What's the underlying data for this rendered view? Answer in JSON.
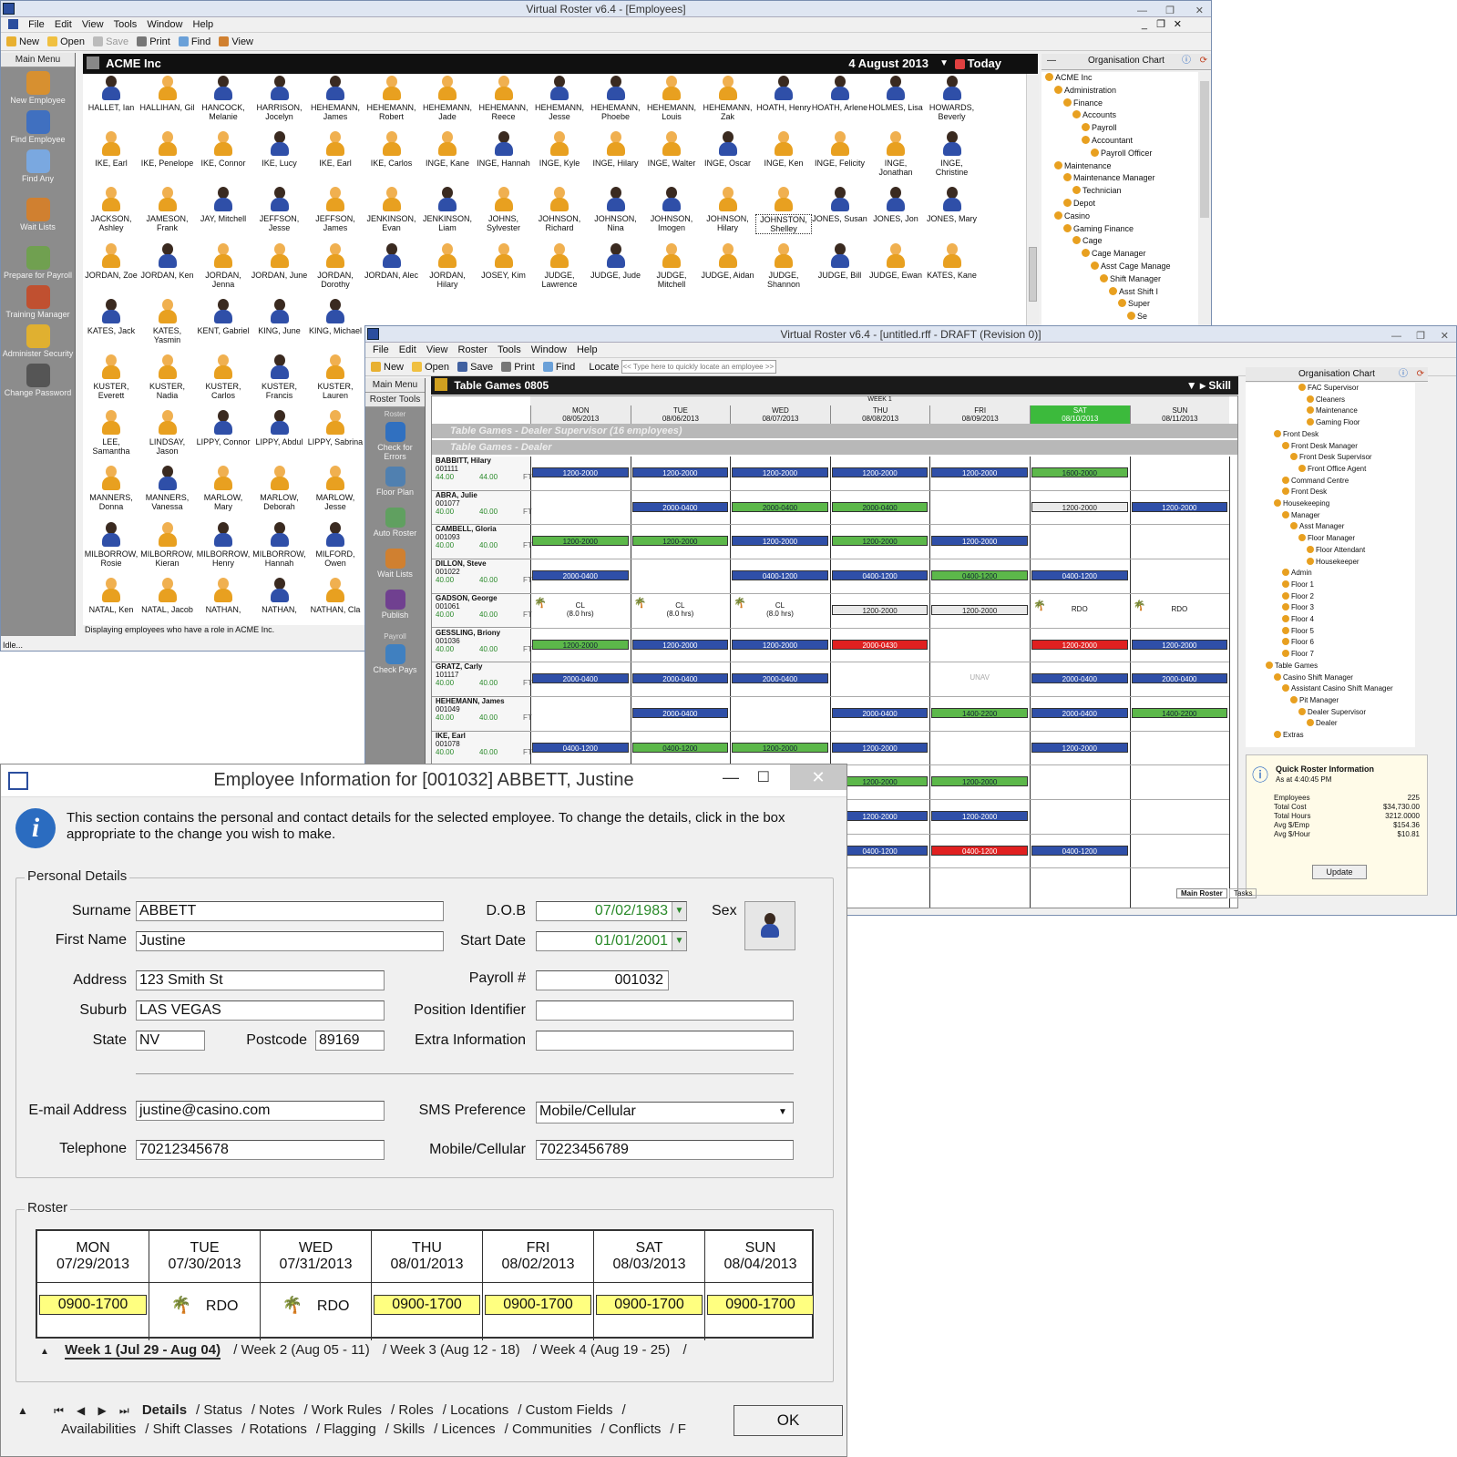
{
  "w1": {
    "title": "Virtual Roster v6.4 - [Employees]",
    "menu": [
      "File",
      "Edit",
      "View",
      "Tools",
      "Window",
      "Help"
    ],
    "toolbar": [
      "New",
      "Open",
      "Save",
      "Print",
      "Find",
      "View"
    ],
    "sidebar_title": "Main Menu",
    "sidebar": [
      "New Employee",
      "Find Employee",
      "Find Any",
      "Wait Lists",
      "Prepare for Payroll",
      "Training Manager",
      "Administer Security",
      "Change Password"
    ],
    "company": "ACME Inc",
    "date": "4 August 2013",
    "today": "Today",
    "status": "Idle...",
    "footer": "Displaying employees who have a role in ACME Inc.",
    "rows": [
      [
        "HALLET, Ian",
        "HALLIHAN, Gil",
        "HANCOCK, Melanie",
        "HARRISON, Jocelyn",
        "HEHEMANN, James",
        "HEHEMANN, Robert",
        "HEHEMANN, Jade",
        "HEHEMANN, Reece",
        "HEHEMANN, Jesse",
        "HEHEMANN, Phoebe",
        "HEHEMANN, Louis",
        "HEHEMANN, Zak",
        "HOATH, Henry",
        "HOATH, Arlene",
        "HOLMES, Lisa",
        "HOWARDS, Beverly"
      ],
      [
        "IKE, Earl",
        "IKE, Penelope",
        "IKE, Connor",
        "IKE, Lucy",
        "IKE, Earl",
        "IKE, Carlos",
        "INGE, Kane",
        "INGE, Hannah",
        "INGE, Kyle",
        "INGE, Hilary",
        "INGE, Walter",
        "INGE, Oscar",
        "INGE, Ken",
        "INGE, Felicity",
        "INGE, Jonathan",
        "INGE, Christine"
      ],
      [
        "JACKSON, Ashley",
        "JAMESON, Frank",
        "JAY, Mitchell",
        "JEFFSON, Jesse",
        "JEFFSON, James",
        "JENKINSON, Evan",
        "JENKINSON, Liam",
        "JOHNS, Sylvester",
        "JOHNSON, Richard",
        "JOHNSON, Nina",
        "JOHNSON, Imogen",
        "JOHNSON, Hilary",
        "JOHNSTON, Shelley",
        "JONES, Susan",
        "JONES, Jon",
        "JONES, Mary"
      ],
      [
        "JORDAN, Zoe",
        "JORDAN, Ken",
        "JORDAN, Jenna",
        "JORDAN, June",
        "JORDAN, Dorothy",
        "JORDAN, Alec",
        "JORDAN, Hilary",
        "JOSEY, Kim",
        "JUDGE, Lawrence",
        "JUDGE, Jude",
        "JUDGE, Mitchell",
        "JUDGE, Aidan",
        "JUDGE, Shannon",
        "JUDGE, Bill",
        "JUDGE, Ewan",
        "KATES, Kane"
      ],
      [
        "KATES, Jack",
        "KATES, Yasmin",
        "KENT, Gabriel",
        "KING, June",
        "KING, Michael"
      ],
      [
        "KUSTER, Everett",
        "KUSTER, Nadia",
        "KUSTER, Carlos",
        "KUSTER, Francis",
        "KUSTER, Lauren"
      ],
      [
        "LEE, Samantha",
        "LINDSAY, Jason",
        "LIPPY, Connor",
        "LIPPY, Abdul",
        "LIPPY, Sabrina"
      ],
      [
        "MANNERS, Donna",
        "MANNERS, Vanessa",
        "MARLOW, Mary",
        "MARLOW, Deborah",
        "MARLOW, Jesse"
      ],
      [
        "MILBORROW, Rosie",
        "MILBORROW, Kieran",
        "MILBORROW, Henry",
        "MILBORROW, Hannah",
        "MILFORD, Owen"
      ],
      [
        "NATAL, Ken",
        "NATAL, Jacob",
        "NATHAN,",
        "NATHAN,",
        "NATHAN, Cla"
      ]
    ],
    "org_title": "Organisation Chart",
    "org": [
      "ACME Inc",
      "Administration",
      "Finance",
      "Accounts",
      "Payroll",
      "Accountant",
      "Payroll Officer",
      "Maintenance",
      "Maintenance Manager",
      "Technician",
      "Depot",
      "Casino",
      "Gaming Finance",
      "Cage",
      "Cage Manager",
      "Asst Cage Manage",
      "Shift Manager",
      "Asst Shift I",
      "Super",
      "Se"
    ]
  },
  "w2": {
    "title": "Virtual Roster v6.4 - [untitled.rff - DRAFT (Revision 0)]",
    "menu": [
      "File",
      "Edit",
      "View",
      "Roster",
      "Tools",
      "Window",
      "Help"
    ],
    "toolbar": [
      "New",
      "Open",
      "Save",
      "Print",
      "Find",
      "Locate"
    ],
    "locate_placeholder": "<< Type here to quickly locate an employee >>",
    "sb_tabs": [
      "Main Menu",
      "Roster Tools"
    ],
    "sb_section1": "Roster",
    "sb_section2": "Payroll",
    "sidebar": [
      "Check for Errors",
      "Floor Plan",
      "Auto Roster",
      "Wait Lists",
      "Publish",
      "Check Pays"
    ],
    "header": "Table Games 0805",
    "skill": "Skill",
    "week": "WEEK 1",
    "days": [
      {
        "d": "MON",
        "dt": "08/05/2013"
      },
      {
        "d": "TUE",
        "dt": "08/06/2013"
      },
      {
        "d": "WED",
        "dt": "08/07/2013"
      },
      {
        "d": "THU",
        "dt": "08/08/2013"
      },
      {
        "d": "FRI",
        "dt": "08/09/2013"
      },
      {
        "d": "SAT",
        "dt": "08/10/2013"
      },
      {
        "d": "SUN",
        "dt": "08/11/2013"
      }
    ],
    "group1": "Table Games - Dealer Supervisor (16 employees)",
    "group2": "Table Games - Dealer",
    "employees": [
      {
        "name": "BABBITT, Hilary",
        "id": "001111",
        "hrs": "44.00",
        "hrs2": "44.00",
        "ft": "FT"
      },
      {
        "name": "ABRA, Julie",
        "id": "001077",
        "hrs": "40.00",
        "hrs2": "40.00",
        "ft": "FT"
      },
      {
        "name": "CAMBELL, Gloria",
        "id": "001093",
        "hrs": "40.00",
        "hrs2": "40.00",
        "ft": "FT"
      },
      {
        "name": "DILLON, Steve",
        "id": "001022",
        "hrs": "40.00",
        "hrs2": "40.00",
        "ft": "FT"
      },
      {
        "name": "GADSON, George",
        "id": "001061",
        "hrs": "40.00",
        "hrs2": "40.00",
        "ft": "FT"
      },
      {
        "name": "GESSLING, Briony",
        "id": "001036",
        "hrs": "40.00",
        "hrs2": "40.00",
        "ft": "FT"
      },
      {
        "name": "GRATZ, Carly",
        "id": "101117",
        "hrs": "40.00",
        "hrs2": "40.00",
        "ft": "FT"
      },
      {
        "name": "HEHEMANN, James",
        "id": "001049",
        "hrs": "40.00",
        "hrs2": "40.00",
        "ft": "FT"
      },
      {
        "name": "IKE, Earl",
        "id": "001078",
        "hrs": "40.00",
        "hrs2": "40.00",
        "ft": "FT"
      }
    ],
    "cl": "CL",
    "cl_hrs": "(8.0 hrs)",
    "rdo": "RDO",
    "unav": "UNAV",
    "org_title": "Organisation Chart",
    "org": [
      "FAC Supervisor",
      "Cleaners",
      "Maintenance",
      "Gaming Floor",
      "Front Desk",
      "Front Desk Manager",
      "Front Desk Supervisor",
      "Front Office Agent",
      "Command Centre",
      "Front Desk",
      "Housekeeping",
      "Manager",
      "Asst Manager",
      "Floor Manager",
      "Floor Attendant",
      "Housekeeper",
      "Admin",
      "Floor 1",
      "Floor 2",
      "Floor 3",
      "Floor 4",
      "Floor 5",
      "Floor 6",
      "Floor 7",
      "Table Games",
      "Casino Shift Manager",
      "Assistant Casino Shift Manager",
      "Pit Manager",
      "Dealer Supervisor",
      "Dealer",
      "Extras"
    ],
    "qri_title": "Quick Roster Information",
    "qri_asat": "As at 4:40:45 PM",
    "qri": [
      {
        "k": "Employees",
        "v": "225"
      },
      {
        "k": "Total Cost",
        "v": "$34,730.00"
      },
      {
        "k": "Total Hours",
        "v": "3212.0000"
      },
      {
        "k": "Avg $/Emp",
        "v": "$154.36"
      },
      {
        "k": "Avg $/Hour",
        "v": "$10.81"
      }
    ],
    "update": "Update",
    "tab_main": "Main Roster",
    "tab_tasks": "Tasks"
  },
  "w3": {
    "title": "Employee Information for [001032] ABBETT, Justine",
    "info": "This section contains the personal and contact details for the selected employee.  To change the details, click in the box appropriate to the change you wish to make.",
    "personal": "Personal Details",
    "labels": {
      "surname": "Surname",
      "first": "First Name",
      "address": "Address",
      "suburb": "Suburb",
      "state": "State",
      "postcode": "Postcode",
      "dob": "D.O.B",
      "start": "Start Date",
      "payroll": "Payroll #",
      "position": "Position Identifier",
      "extra": "Extra Information",
      "sex": "Sex",
      "email": "E-mail Address",
      "sms": "SMS Preference",
      "tel": "Telephone",
      "mobile": "Mobile/Cellular"
    },
    "values": {
      "surname": "ABBETT",
      "first": "Justine",
      "address": "123 Smith St",
      "suburb": "LAS VEGAS",
      "state": "NV",
      "postcode": "89169",
      "dob": "07/02/1983",
      "start": "01/01/2001",
      "payroll": "001032",
      "position": "",
      "extra": "",
      "email": "justine@casino.com",
      "sms": "Mobile/Cellular",
      "tel": "70212345678",
      "mobile": "70223456789"
    },
    "roster_title": "Roster",
    "roster": [
      {
        "d": "MON",
        "dt": "07/29/2013",
        "s": "0900-1700"
      },
      {
        "d": "TUE",
        "dt": "07/30/2013",
        "s": "RDO"
      },
      {
        "d": "WED",
        "dt": "07/31/2013",
        "s": "RDO"
      },
      {
        "d": "THU",
        "dt": "08/01/2013",
        "s": "0900-1700"
      },
      {
        "d": "FRI",
        "dt": "08/02/2013",
        "s": "0900-1700"
      },
      {
        "d": "SAT",
        "dt": "08/03/2013",
        "s": "0900-1700"
      },
      {
        "d": "SUN",
        "dt": "08/04/2013",
        "s": "0900-1700"
      }
    ],
    "weeks": [
      "Week 1 (Jul 29 - Aug 04)",
      "Week 2 (Aug 05 - 11)",
      "Week 3 (Aug 12 - 18)",
      "Week 4 (Aug 19 - 25)"
    ],
    "tabs1": [
      "Details",
      "Status",
      "Notes",
      "Work Rules",
      "Roles",
      "Locations",
      "Custom Fields"
    ],
    "tabs2": [
      "Availabilities",
      "Shift Classes",
      "Rotations",
      "Flagging",
      "Skills",
      "Licences",
      "Communities",
      "Conflicts",
      "F"
    ],
    "ok": "OK"
  },
  "colors": {
    "accent": "#2f4fa8",
    "green": "#5cb84a",
    "red": "#e02020",
    "yellow": "#ffff80",
    "orange": "#e8a020"
  }
}
